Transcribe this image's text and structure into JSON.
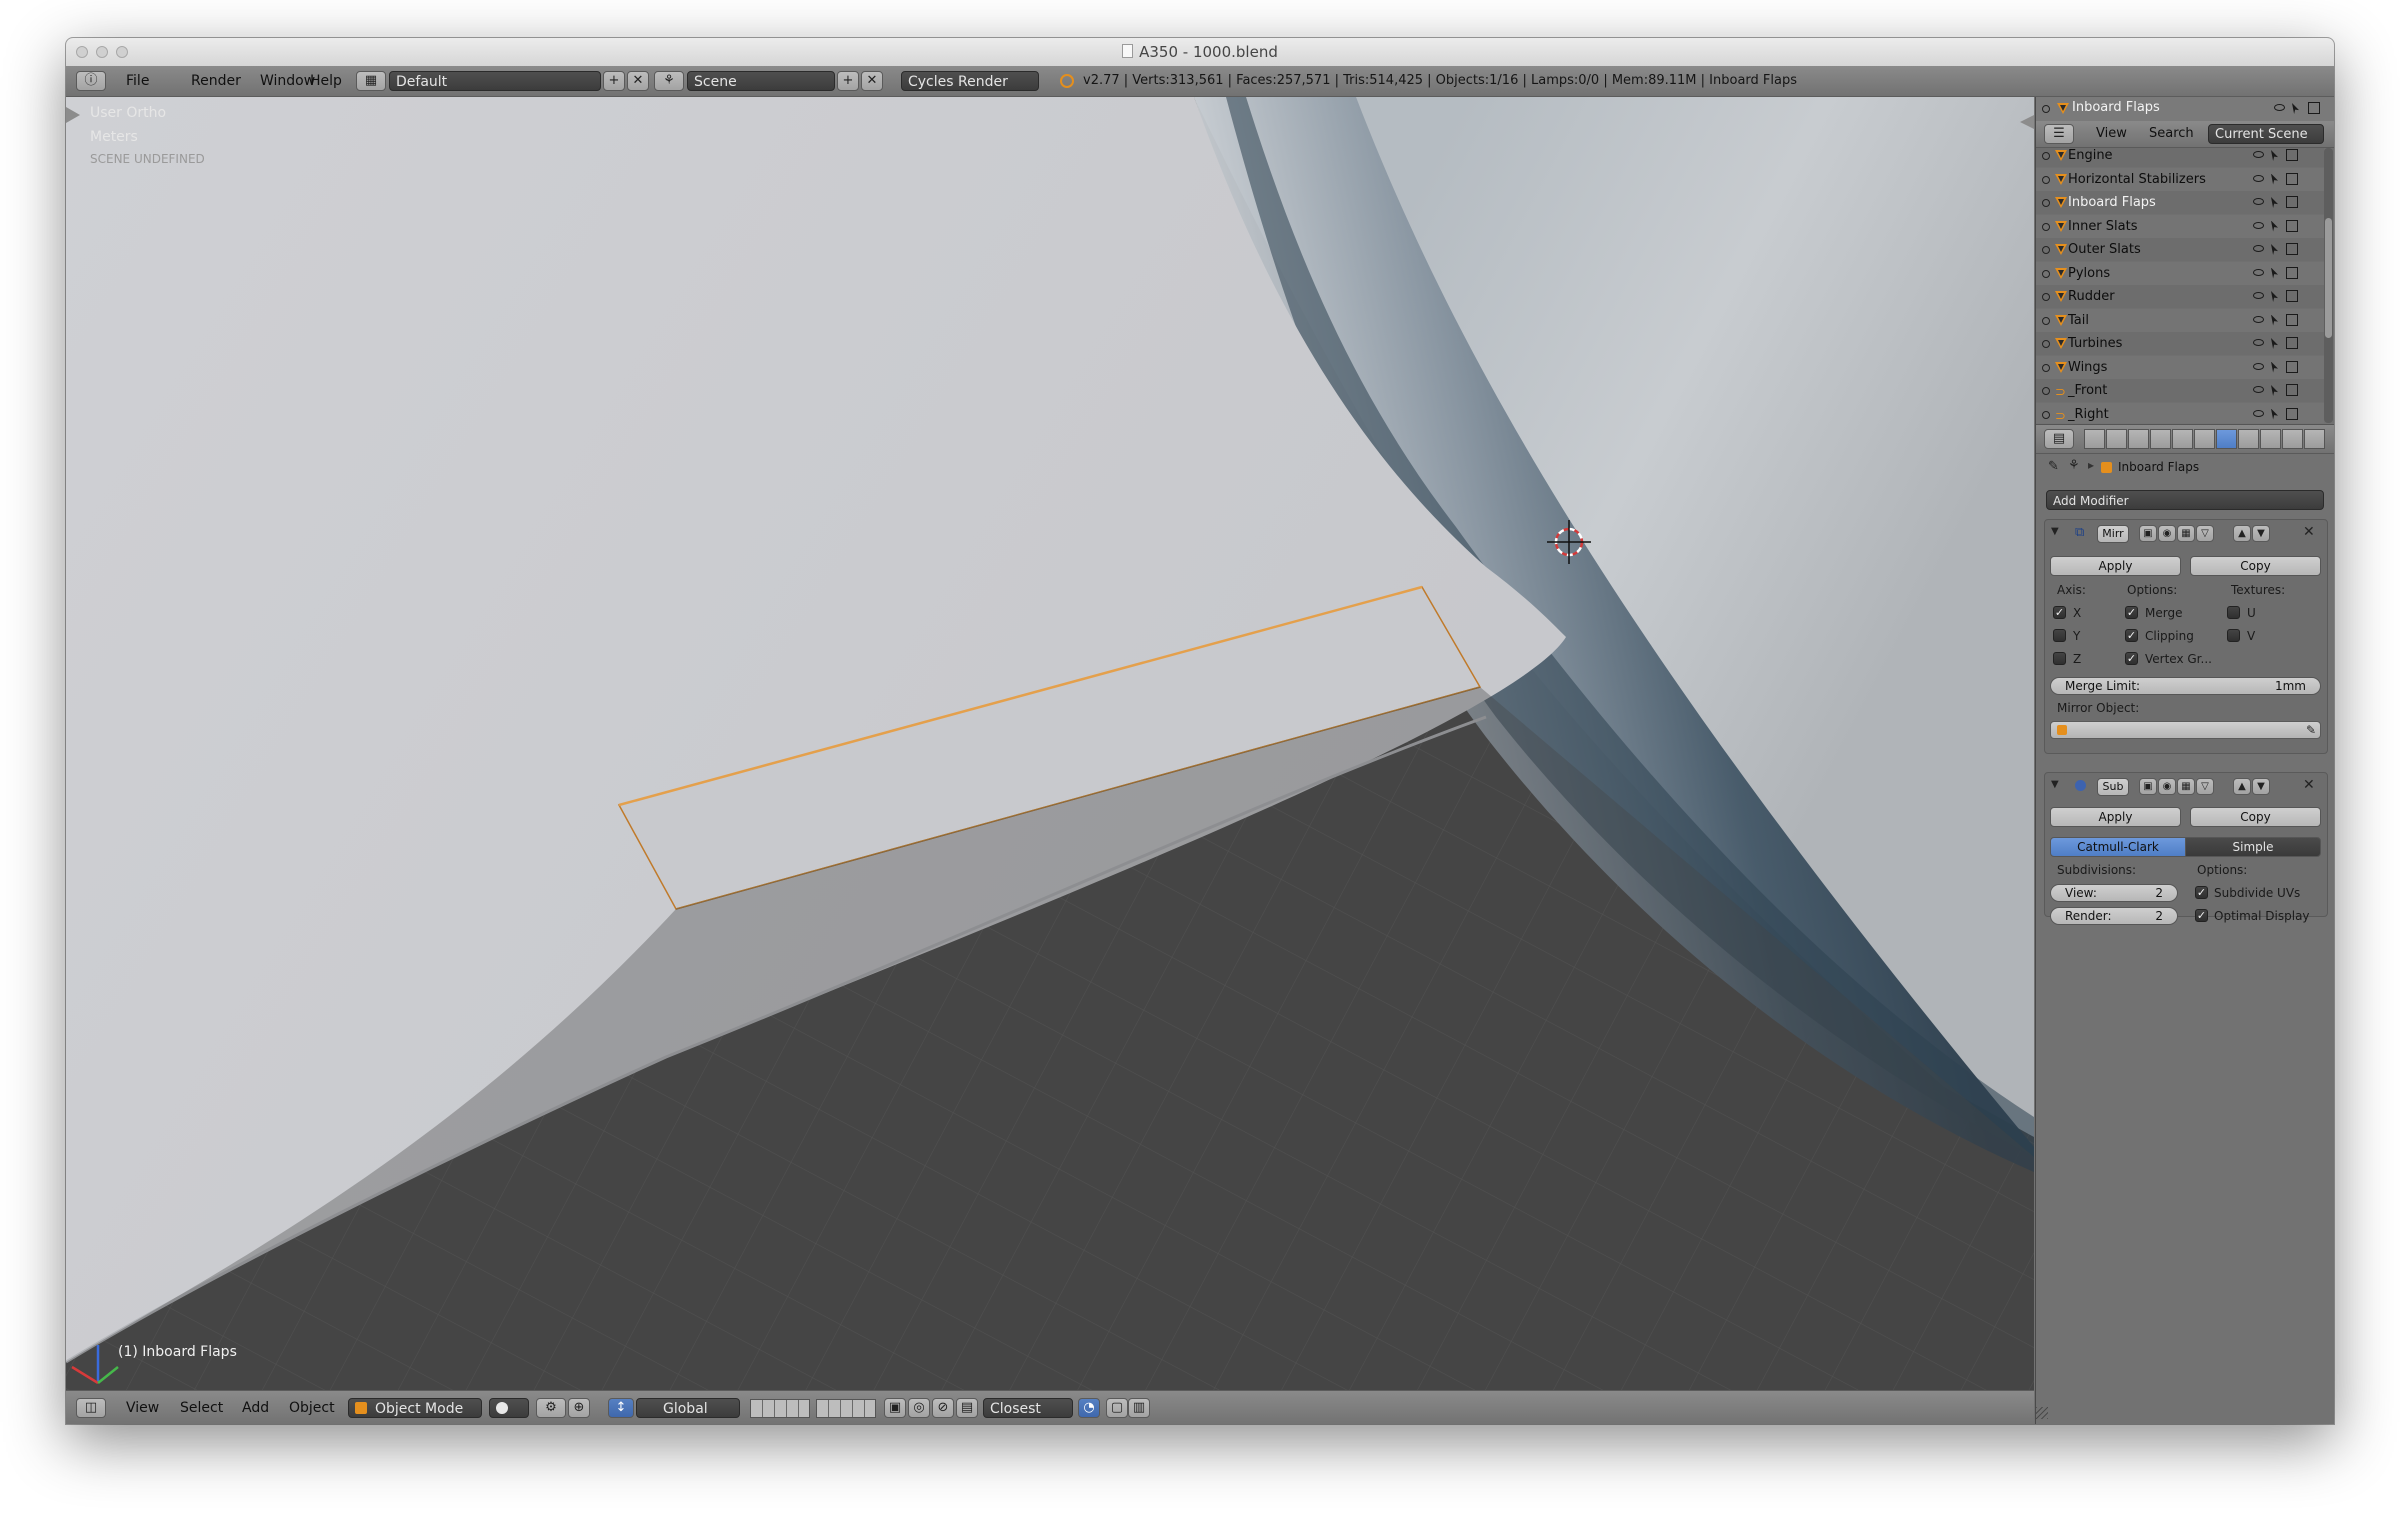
{
  "window": {
    "title": "A350 - 1000.blend"
  },
  "topbar": {
    "menus": [
      "File",
      "Render",
      "Window",
      "Help"
    ],
    "layout": "Default",
    "scene": "Scene",
    "render_engine": "Cycles Render",
    "stats": "v2.77 | Verts:313,561 | Faces:257,571 | Tris:514,425 | Objects:1/16 | Lamps:0/0 | Mem:89.11M | Inboard Flaps"
  },
  "viewport": {
    "view_name": "User Ortho",
    "units": "Meters",
    "scene_note": "SCENE UNDEFINED",
    "active_object": "(1) Inboard Flaps"
  },
  "bottombar": {
    "menus": [
      "View",
      "Select",
      "Add",
      "Object"
    ],
    "mode": "Object Mode",
    "orientation": "Global",
    "snap": "Closest"
  },
  "outliner": {
    "header_object": "Inboard Flaps",
    "tabs": [
      "View",
      "Search",
      "Current Scene"
    ],
    "items": [
      {
        "name": "Engine",
        "selected": false
      },
      {
        "name": "Horizontal Stabilizers",
        "selected": false
      },
      {
        "name": "Inboard Flaps",
        "selected": true
      },
      {
        "name": "Inner Slats",
        "selected": false
      },
      {
        "name": "Outer Slats",
        "selected": false
      },
      {
        "name": "Pylons",
        "selected": false
      },
      {
        "name": "Rudder",
        "selected": false
      },
      {
        "name": "Tail",
        "selected": false
      },
      {
        "name": "Turbines",
        "selected": false
      },
      {
        "name": "Wings",
        "selected": false
      },
      {
        "name": "_Front",
        "selected": false
      },
      {
        "name": "_Right",
        "selected": false
      }
    ]
  },
  "properties": {
    "context_object": "Inboard Flaps",
    "add_modifier": "Add Modifier",
    "mirror": {
      "name": "Mirr",
      "apply": "Apply",
      "copy": "Copy",
      "axis_label": "Axis:",
      "options_label": "Options:",
      "textures_label": "Textures:",
      "axis": [
        {
          "label": "X",
          "checked": true
        },
        {
          "label": "Y",
          "checked": false
        },
        {
          "label": "Z",
          "checked": false
        }
      ],
      "options": [
        {
          "label": "Merge",
          "checked": true
        },
        {
          "label": "Clipping",
          "checked": true
        },
        {
          "label": "Vertex Gr...",
          "checked": true
        }
      ],
      "textures": [
        {
          "label": "U",
          "checked": false
        },
        {
          "label": "V",
          "checked": false
        }
      ],
      "merge_limit_label": "Merge Limit:",
      "merge_limit_value": "1mm",
      "mirror_object_label": "Mirror Object:"
    },
    "subsurf": {
      "name": "Sub",
      "apply": "Apply",
      "copy": "Copy",
      "type_active": "Catmull-Clark",
      "type_other": "Simple",
      "subdivisions_label": "Subdivisions:",
      "options_label": "Options:",
      "view_label": "View:",
      "view_value": "2",
      "render_label": "Render:",
      "render_value": "2",
      "subdivide_uvs": "Subdivide UVs",
      "optimal_display": "Optimal Display"
    }
  },
  "colors": {
    "selected_highlight": "#5680c2",
    "object_orange": "#e58f1d",
    "viewport_bg": "#444444",
    "ui_gray": "#727272"
  }
}
